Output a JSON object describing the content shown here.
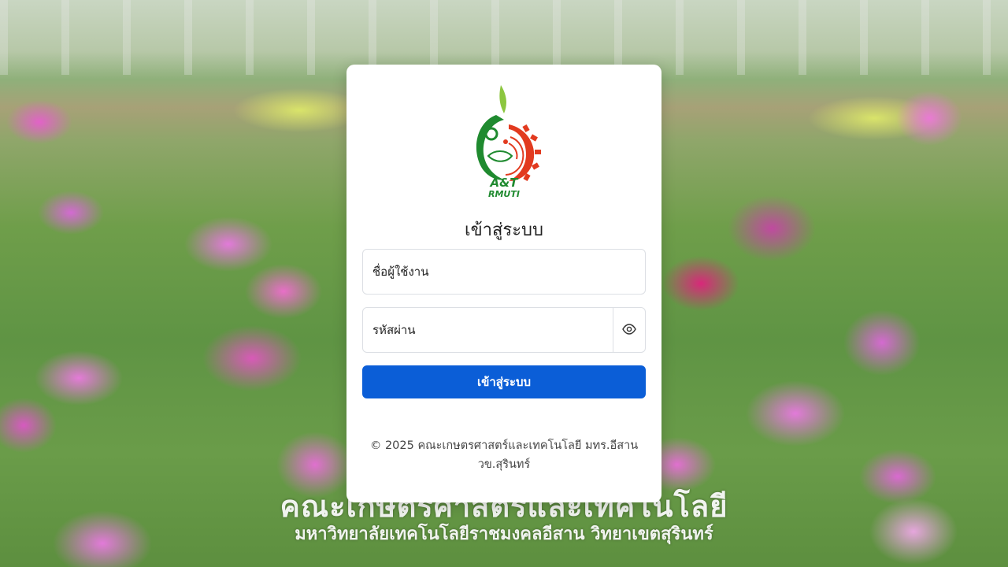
{
  "background": {
    "watermark_line1": "คณะเกษตรศาสตร์และเทคโนโลยี",
    "watermark_line2": "มหาวิทยาลัยเทคโนโลยีราชมงคลอีสาน วิทยาเขตสุรินทร์"
  },
  "logo": {
    "line1": "A&T",
    "line2": "RMUTI",
    "colors": {
      "green": "#1f8a2f",
      "red": "#e23a1f",
      "leaf": "#8cc63f"
    }
  },
  "login": {
    "title": "เข้าสู่ระบบ",
    "username_placeholder": "ชื่อผู้ใช้งาน",
    "username_value": "",
    "password_placeholder": "รหัสผ่าน",
    "password_value": "",
    "toggle_icon": "eye-icon",
    "submit_label": "เข้าสู่ระบบ",
    "accent_color": "#0b5ed7"
  },
  "footer": {
    "line1": "© 2025 คณะเกษตรศาสตร์และเทคโนโลยี มทร.อีสาน",
    "line2": "วข.สุรินทร์"
  }
}
